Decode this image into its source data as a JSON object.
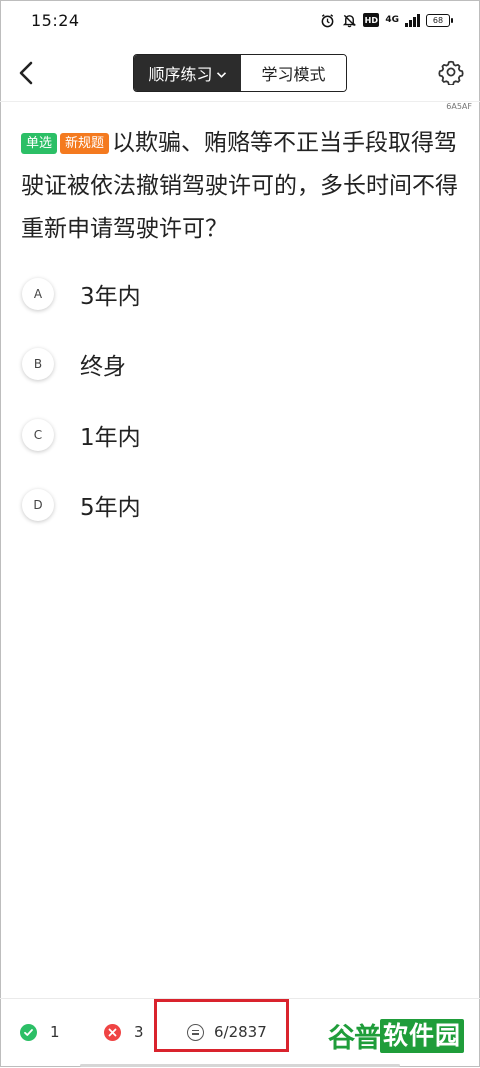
{
  "status_bar": {
    "time": "15:24",
    "network": "4G",
    "hd_badge": "HD",
    "battery": "68",
    "icons": [
      "alarm-icon",
      "bell-off-icon",
      "hd-icon",
      "signal-icon",
      "battery-icon"
    ]
  },
  "nav": {
    "mode_selected": "顺序练习",
    "mode_other": "学习模式",
    "icons": [
      "back-arrow-icon",
      "chevron-down-icon",
      "gear-icon"
    ],
    "code": "6A5AF"
  },
  "question": {
    "tag_type": "单选",
    "tag_new": "新规题",
    "text": "以欺骗、贿赂等不正当手段取得驾驶证被依法撤销驾驶许可的，多长时间不得重新申请驾驶许可？"
  },
  "options": [
    {
      "letter": "A",
      "text": "3年内"
    },
    {
      "letter": "B",
      "text": "终身"
    },
    {
      "letter": "C",
      "text": "1年内"
    },
    {
      "letter": "D",
      "text": "5年内"
    }
  ],
  "bottom": {
    "correct_count": "1",
    "wrong_count": "3",
    "progress": "6/2837",
    "icons": [
      "check-circle-icon",
      "x-circle-icon",
      "list-circle-icon"
    ],
    "watermark_a": "谷普",
    "watermark_b": "软件园"
  },
  "colors": {
    "accent_dark": "#2c2c2c",
    "tag_green": "#2cbf66",
    "tag_orange": "#f47a1f",
    "wrong_red": "#ef4444",
    "highlight_red": "#d9232d",
    "watermark_green": "#1f9d3a"
  }
}
